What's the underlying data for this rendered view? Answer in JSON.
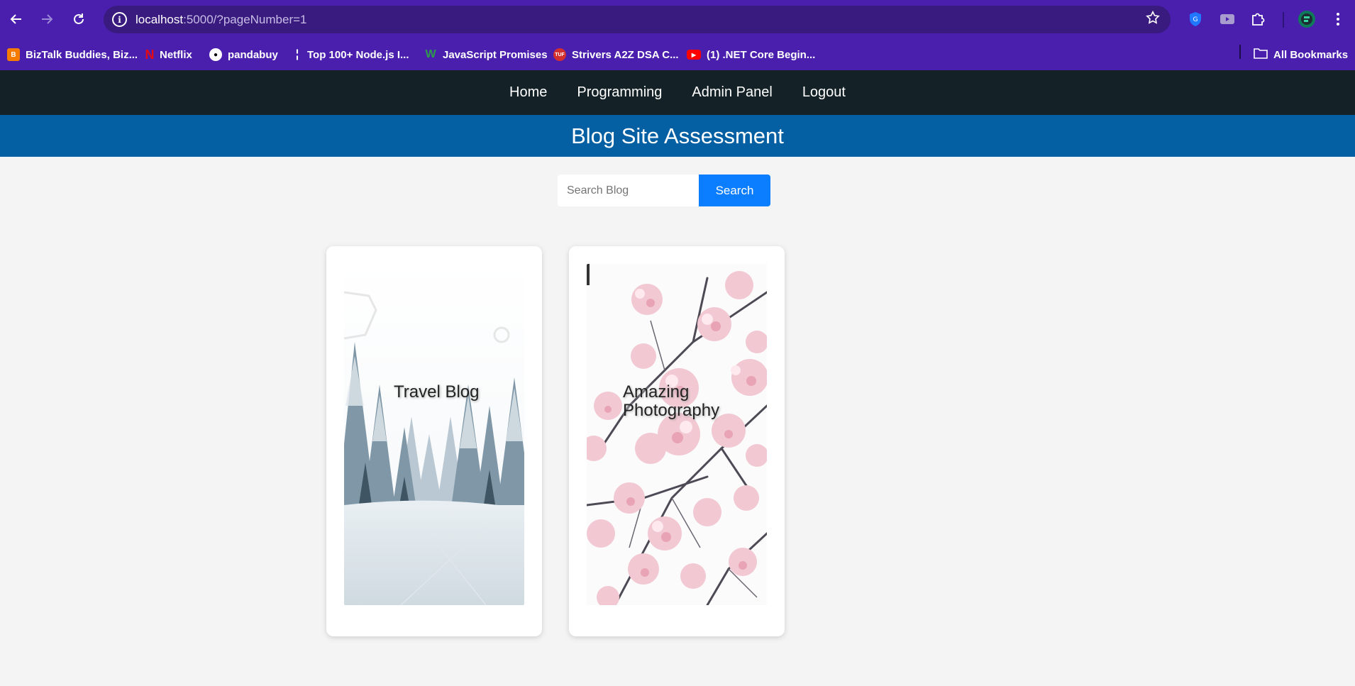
{
  "browser": {
    "url_host": "localhost",
    "url_rest": ":5000/?pageNumber=1",
    "bookmarks": [
      {
        "label": "BizTalk Buddies, Biz...",
        "icon": "blogger-icon",
        "color": "#f57c00"
      },
      {
        "label": "Netflix",
        "icon": "netflix-icon",
        "color": "#e50914"
      },
      {
        "label": "pandabuy",
        "icon": "pandabuy-icon",
        "color": "#ffffff"
      },
      {
        "label": "Top 100+ Node.js I...",
        "icon": "nodejs-icon",
        "color": "#ffffff"
      },
      {
        "label": "JavaScript Promises",
        "icon": "w3-icon",
        "color": "#2e9a4b"
      },
      {
        "label": "Strivers A2Z DSA C...",
        "icon": "tuf-icon",
        "color": "#d32f2f"
      },
      {
        "label": "(1) .NET Core Begin...",
        "icon": "youtube-icon",
        "color": "#ff0000"
      }
    ],
    "all_bookmarks_label": "All Bookmarks"
  },
  "nav": {
    "items": [
      "Home",
      "Programming",
      "Admin Panel",
      "Logout"
    ]
  },
  "header": {
    "title": "Blog Site Assessment"
  },
  "search": {
    "placeholder": "Search Blog",
    "button_label": "Search"
  },
  "cards": [
    {
      "title": "Travel Blog",
      "image": "snowy-forest"
    },
    {
      "title": "Amazing Photography",
      "image": "cherry-blossom"
    }
  ],
  "colors": {
    "browser_bar": "#4a1fae",
    "navbar": "#142228",
    "banner": "#045fa3",
    "search_button": "#0a7eff",
    "page_bg": "#f4f4f4"
  }
}
